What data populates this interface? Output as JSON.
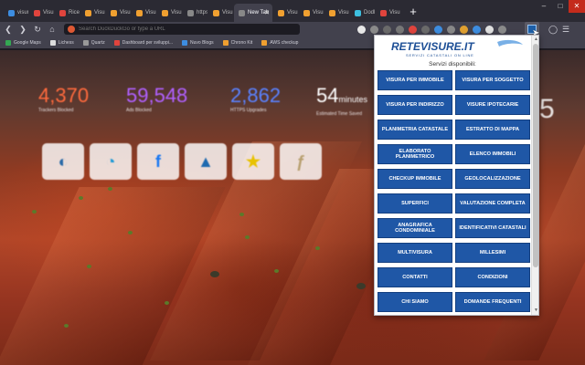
{
  "browser": {
    "tabs": [
      {
        "title": "visura c",
        "color": "#3d8de0"
      },
      {
        "title": "Visure",
        "color": "#e0443d"
      },
      {
        "title": "Ricerca",
        "color": "#e0443d"
      },
      {
        "title": "Visura",
        "color": "#f0a030"
      },
      {
        "title": "Visura",
        "color": "#f0a030"
      },
      {
        "title": "Visura",
        "color": "#f0a030"
      },
      {
        "title": "Visura",
        "color": "#f0a030"
      },
      {
        "title": "https:",
        "color": "#888888"
      },
      {
        "title": "Visura",
        "color": "#f0a030"
      },
      {
        "title": "New Tab",
        "color": "#888888"
      },
      {
        "title": "Visura",
        "color": "#f0a030"
      },
      {
        "title": "Visura",
        "color": "#f0a030"
      },
      {
        "title": "Visura",
        "color": "#f0a030"
      },
      {
        "title": "DodB",
        "color": "#3dc0e0"
      },
      {
        "title": "Visura",
        "color": "#e0443d"
      }
    ],
    "active_tab": "New Tab",
    "new_tab_symbol": "+",
    "url_placeholder": "Search DuckDuckGo or type a URL",
    "bookmarks": [
      {
        "label": "Google Maps",
        "color": "#34a853"
      },
      {
        "label": "Lichess",
        "color": "#dddddd"
      },
      {
        "label": "Quartz",
        "color": "#999999"
      },
      {
        "label": "Dashboard per sviluppi...",
        "color": "#e0443d"
      },
      {
        "label": "Nuvo Blogs",
        "color": "#3d8de0"
      },
      {
        "label": "Chrono Kit",
        "color": "#f0a030"
      },
      {
        "label": "AWS checkup",
        "color": "#f0a030"
      }
    ]
  },
  "newtab": {
    "stats": [
      {
        "value": "4,370",
        "label": "Trackers Blocked",
        "color": "#ff6a3d"
      },
      {
        "value": "59,548",
        "label": "Ads Blocked",
        "color": "#b060ff"
      },
      {
        "value": "2,862",
        "label": "HTTPS Upgrades",
        "color": "#5a82ff"
      },
      {
        "value": "54",
        "unit": "minutes",
        "label": "Estimated Time Saved",
        "color": "#ffffff"
      }
    ],
    "ghost_text": "5",
    "shortcuts": [
      {
        "icon": "globe-icon",
        "glyph": "◐",
        "color": "#2a6aa8"
      },
      {
        "icon": "speed-dial-icon",
        "glyph": "◔",
        "color": "#1e9ad6"
      },
      {
        "icon": "facebook-icon",
        "glyph": "f",
        "color": "#1877f2"
      },
      {
        "icon": "mountain-icon",
        "glyph": "▲",
        "color": "#1e6ab0"
      },
      {
        "icon": "star-icon",
        "glyph": "★",
        "color": "#e8c200"
      },
      {
        "icon": "letter-f-icon",
        "glyph": "ƒ",
        "color": "#b8a070"
      }
    ]
  },
  "popup": {
    "logo_main": "RETEVISURE.IT",
    "logo_sub": "SERVIZI CATASTALI ON LINE",
    "title": "Servizi disponibili:",
    "services": [
      "Visura per immobile",
      "Visura per soggetto",
      "Visura per indirizzo",
      "Visure ipotecarie",
      "Planimetria catastale",
      "Estratto di mappa",
      "Elaborato planimetrico",
      "Elenco immobili",
      "Checkup immobile",
      "Geolocalizzazione",
      "Superfici",
      "Valutazione completa",
      "Anagrafica condominiale",
      "Identificativi catastali",
      "Multivisura",
      "Millesimi",
      "Contatti",
      "Condizioni",
      "Chi siamo",
      "Domande frequenti"
    ],
    "accent": "#1f57a6"
  }
}
